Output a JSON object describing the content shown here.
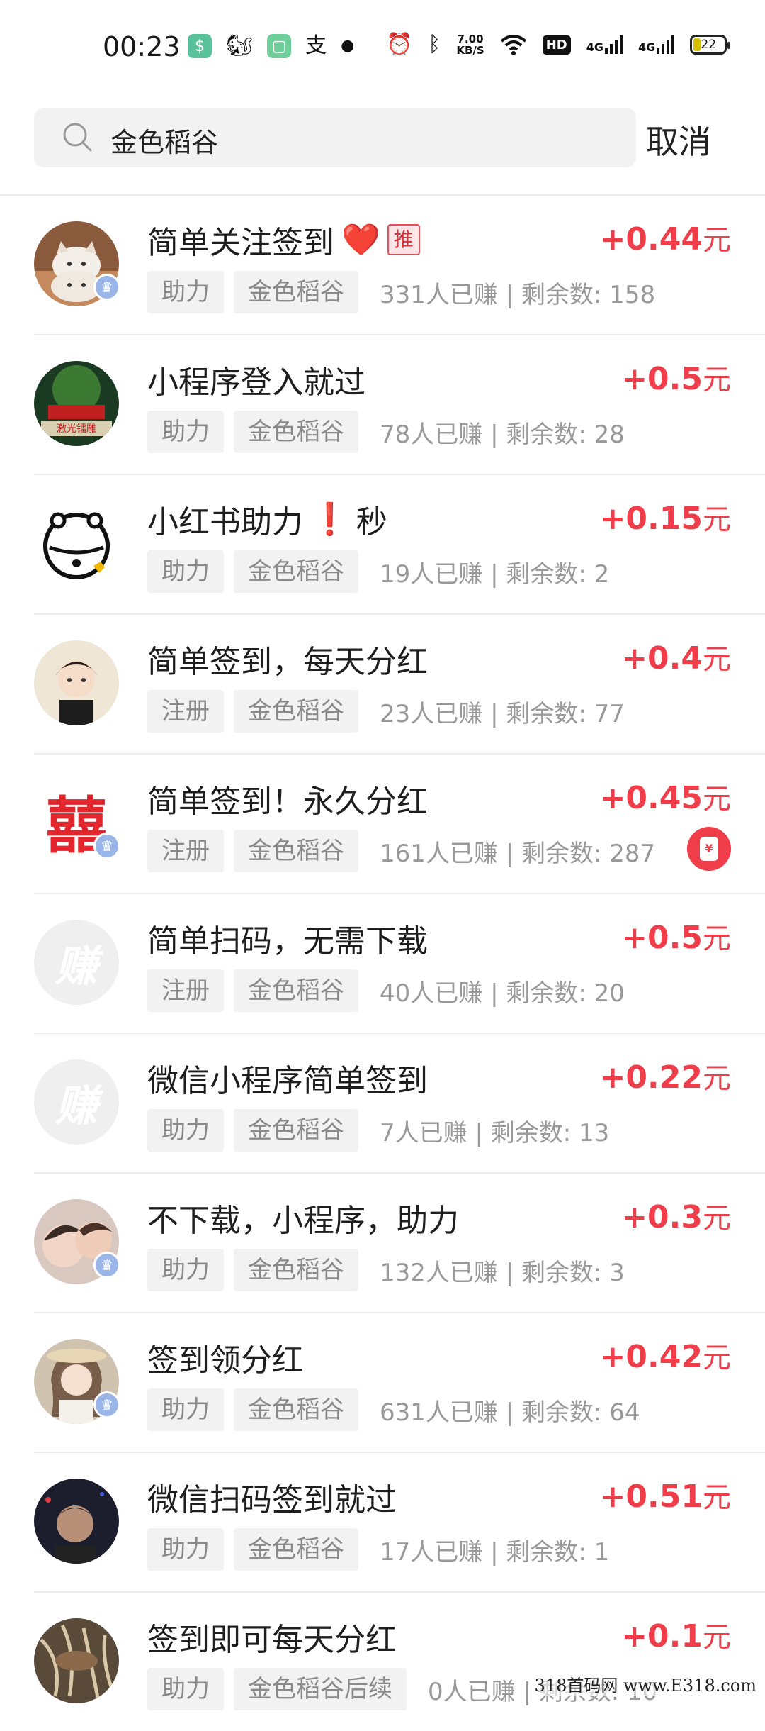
{
  "status_bar": {
    "time": "00:23",
    "net_speed_top": "7.00",
    "net_speed_bottom": "KB/S",
    "hd": "HD",
    "net_a": "4G",
    "net_b": "4G",
    "battery": "22"
  },
  "search": {
    "query": "金色稻谷",
    "cancel_label": "取消"
  },
  "tasks": [
    {
      "title": "简单关注签到",
      "heart": "❤️",
      "rec_badge": "推",
      "type_tag": "助力",
      "source_tag": "金色稻谷",
      "stats": "331人已赚 | 剩余数: 158",
      "price": "+0.44",
      "unit": "元",
      "avatar": "cats",
      "verified": true
    },
    {
      "title": "小程序登入就过",
      "type_tag": "助力",
      "source_tag": "金色稻谷",
      "stats": "78人已赚 | 剩余数: 28",
      "price": "+0.5",
      "unit": "元",
      "avatar": "store",
      "verified": false
    },
    {
      "title": "小红书助力",
      "exclaim": "❗",
      "title_suffix": "秒",
      "type_tag": "助力",
      "source_tag": "金色稻谷",
      "stats": "19人已赚 | 剩余数: 2",
      "price": "+0.15",
      "unit": "元",
      "avatar": "bell",
      "verified": false
    },
    {
      "title": "简单签到，每天分红",
      "type_tag": "注册",
      "source_tag": "金色稻谷",
      "stats": "23人已赚 | 剩余数: 77",
      "price": "+0.4",
      "unit": "元",
      "avatar": "boy",
      "verified": false
    },
    {
      "title": "简单签到！永久分红",
      "type_tag": "注册",
      "source_tag": "金色稻谷",
      "stats": "161人已赚 | 剩余数: 287",
      "price": "+0.45",
      "unit": "元",
      "avatar": "xi",
      "verified": true,
      "coin": "¥"
    },
    {
      "title": "简单扫码，无需下载",
      "type_tag": "注册",
      "source_tag": "金色稻谷",
      "stats": "40人已赚 | 剩余数: 20",
      "price": "+0.5",
      "unit": "元",
      "avatar": "placeholder",
      "avatar_text": "赚",
      "verified": false
    },
    {
      "title": "微信小程序简单签到",
      "type_tag": "助力",
      "source_tag": "金色稻谷",
      "stats": "7人已赚 | 剩余数: 13",
      "price": "+0.22",
      "unit": "元",
      "avatar": "placeholder",
      "avatar_text": "赚",
      "verified": false
    },
    {
      "title": "不下载，小程序，助力",
      "type_tag": "助力",
      "source_tag": "金色稻谷",
      "stats": "132人已赚 | 剩余数: 3",
      "price": "+0.3",
      "unit": "元",
      "avatar": "kid",
      "verified": true
    },
    {
      "title": "签到领分红",
      "type_tag": "助力",
      "source_tag": "金色稻谷",
      "stats": "631人已赚 | 剩余数: 64",
      "price": "+0.42",
      "unit": "元",
      "avatar": "girl",
      "verified": true
    },
    {
      "title": "微信扫码签到就过",
      "type_tag": "助力",
      "source_tag": "金色稻谷",
      "stats": "17人已赚 | 剩余数: 1",
      "price": "+0.51",
      "unit": "元",
      "avatar": "dark",
      "verified": false
    },
    {
      "title": "签到即可每天分红",
      "type_tag": "助力",
      "source_tag": "金色稻谷后续",
      "stats": "0人已赚 | 剩余数: 10",
      "price": "+0.1",
      "unit": "元",
      "avatar": "roots",
      "verified": false
    }
  ],
  "watermark": "318首码网 www.E318.com"
}
